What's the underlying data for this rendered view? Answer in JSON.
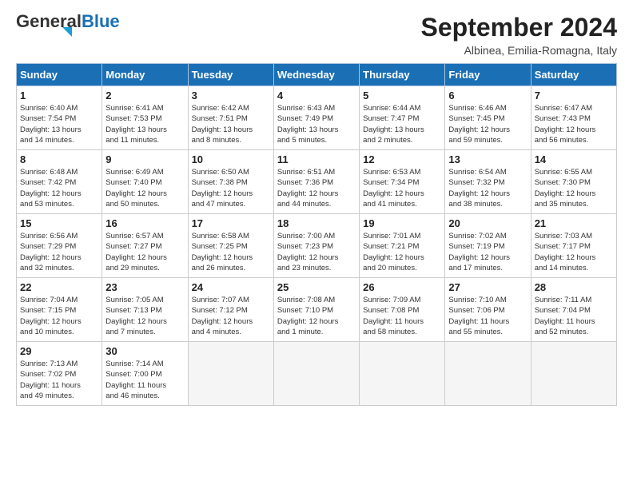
{
  "header": {
    "logo_general": "General",
    "logo_blue": "Blue",
    "month_title": "September 2024",
    "subtitle": "Albinea, Emilia-Romagna, Italy"
  },
  "days_of_week": [
    "Sunday",
    "Monday",
    "Tuesday",
    "Wednesday",
    "Thursday",
    "Friday",
    "Saturday"
  ],
  "weeks": [
    [
      {
        "day": 1,
        "info": "Sunrise: 6:40 AM\nSunset: 7:54 PM\nDaylight: 13 hours\nand 14 minutes."
      },
      {
        "day": 2,
        "info": "Sunrise: 6:41 AM\nSunset: 7:53 PM\nDaylight: 13 hours\nand 11 minutes."
      },
      {
        "day": 3,
        "info": "Sunrise: 6:42 AM\nSunset: 7:51 PM\nDaylight: 13 hours\nand 8 minutes."
      },
      {
        "day": 4,
        "info": "Sunrise: 6:43 AM\nSunset: 7:49 PM\nDaylight: 13 hours\nand 5 minutes."
      },
      {
        "day": 5,
        "info": "Sunrise: 6:44 AM\nSunset: 7:47 PM\nDaylight: 13 hours\nand 2 minutes."
      },
      {
        "day": 6,
        "info": "Sunrise: 6:46 AM\nSunset: 7:45 PM\nDaylight: 12 hours\nand 59 minutes."
      },
      {
        "day": 7,
        "info": "Sunrise: 6:47 AM\nSunset: 7:43 PM\nDaylight: 12 hours\nand 56 minutes."
      }
    ],
    [
      {
        "day": 8,
        "info": "Sunrise: 6:48 AM\nSunset: 7:42 PM\nDaylight: 12 hours\nand 53 minutes."
      },
      {
        "day": 9,
        "info": "Sunrise: 6:49 AM\nSunset: 7:40 PM\nDaylight: 12 hours\nand 50 minutes."
      },
      {
        "day": 10,
        "info": "Sunrise: 6:50 AM\nSunset: 7:38 PM\nDaylight: 12 hours\nand 47 minutes."
      },
      {
        "day": 11,
        "info": "Sunrise: 6:51 AM\nSunset: 7:36 PM\nDaylight: 12 hours\nand 44 minutes."
      },
      {
        "day": 12,
        "info": "Sunrise: 6:53 AM\nSunset: 7:34 PM\nDaylight: 12 hours\nand 41 minutes."
      },
      {
        "day": 13,
        "info": "Sunrise: 6:54 AM\nSunset: 7:32 PM\nDaylight: 12 hours\nand 38 minutes."
      },
      {
        "day": 14,
        "info": "Sunrise: 6:55 AM\nSunset: 7:30 PM\nDaylight: 12 hours\nand 35 minutes."
      }
    ],
    [
      {
        "day": 15,
        "info": "Sunrise: 6:56 AM\nSunset: 7:29 PM\nDaylight: 12 hours\nand 32 minutes."
      },
      {
        "day": 16,
        "info": "Sunrise: 6:57 AM\nSunset: 7:27 PM\nDaylight: 12 hours\nand 29 minutes."
      },
      {
        "day": 17,
        "info": "Sunrise: 6:58 AM\nSunset: 7:25 PM\nDaylight: 12 hours\nand 26 minutes."
      },
      {
        "day": 18,
        "info": "Sunrise: 7:00 AM\nSunset: 7:23 PM\nDaylight: 12 hours\nand 23 minutes."
      },
      {
        "day": 19,
        "info": "Sunrise: 7:01 AM\nSunset: 7:21 PM\nDaylight: 12 hours\nand 20 minutes."
      },
      {
        "day": 20,
        "info": "Sunrise: 7:02 AM\nSunset: 7:19 PM\nDaylight: 12 hours\nand 17 minutes."
      },
      {
        "day": 21,
        "info": "Sunrise: 7:03 AM\nSunset: 7:17 PM\nDaylight: 12 hours\nand 14 minutes."
      }
    ],
    [
      {
        "day": 22,
        "info": "Sunrise: 7:04 AM\nSunset: 7:15 PM\nDaylight: 12 hours\nand 10 minutes."
      },
      {
        "day": 23,
        "info": "Sunrise: 7:05 AM\nSunset: 7:13 PM\nDaylight: 12 hours\nand 7 minutes."
      },
      {
        "day": 24,
        "info": "Sunrise: 7:07 AM\nSunset: 7:12 PM\nDaylight: 12 hours\nand 4 minutes."
      },
      {
        "day": 25,
        "info": "Sunrise: 7:08 AM\nSunset: 7:10 PM\nDaylight: 12 hours\nand 1 minute."
      },
      {
        "day": 26,
        "info": "Sunrise: 7:09 AM\nSunset: 7:08 PM\nDaylight: 11 hours\nand 58 minutes."
      },
      {
        "day": 27,
        "info": "Sunrise: 7:10 AM\nSunset: 7:06 PM\nDaylight: 11 hours\nand 55 minutes."
      },
      {
        "day": 28,
        "info": "Sunrise: 7:11 AM\nSunset: 7:04 PM\nDaylight: 11 hours\nand 52 minutes."
      }
    ],
    [
      {
        "day": 29,
        "info": "Sunrise: 7:13 AM\nSunset: 7:02 PM\nDaylight: 11 hours\nand 49 minutes."
      },
      {
        "day": 30,
        "info": "Sunrise: 7:14 AM\nSunset: 7:00 PM\nDaylight: 11 hours\nand 46 minutes."
      },
      null,
      null,
      null,
      null,
      null
    ]
  ]
}
